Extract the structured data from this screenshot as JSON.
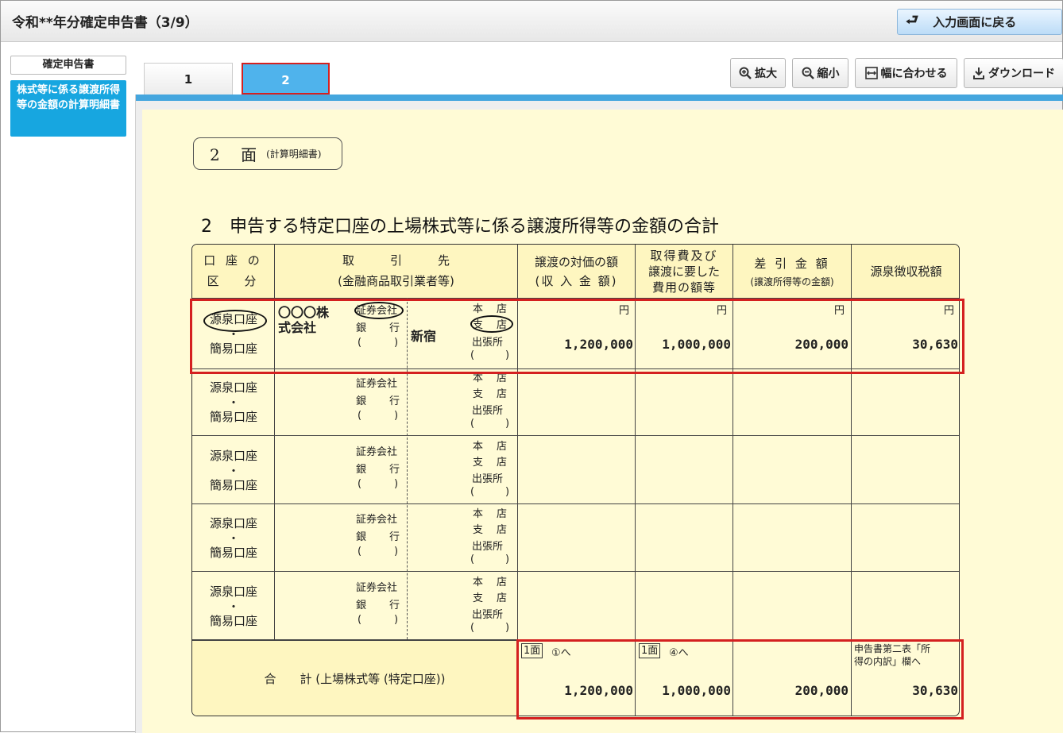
{
  "header": {
    "title": "令和**年分確定申告書（3/9）",
    "back_label": "入力画面に戻る"
  },
  "nav": {
    "title": "確定申告書",
    "item": "株式等に係る譲渡所得等の金額の計算明細書"
  },
  "tabs": [
    {
      "label": "1"
    },
    {
      "label": "2"
    }
  ],
  "toolbar": {
    "zoom_in": "拡大",
    "zoom_out": "縮小",
    "fit_width": "幅に合わせる",
    "download": "ダウンロード"
  },
  "document": {
    "badge_main": "2 面",
    "badge_sub": "(計算明細書)",
    "section_title": "2　申告する特定口座の上場株式等に係る譲渡所得等の金額の合計",
    "headers": {
      "account_type_1": "口 座 の",
      "account_type_2": "区　 分",
      "counterparty_1": "取　　　引　　　先",
      "counterparty_2": "(金融商品取引業者等)",
      "proceeds_1": "譲渡の対価の額",
      "proceeds_2": "(収 入 金 額)",
      "cost_1": "取得費及び",
      "cost_2": "譲渡に要した",
      "cost_3": "費用の額等",
      "diff_1": "差 引 金 額",
      "diff_2": "(譲渡所得等の金額)",
      "tax": "源泉徴収税額"
    },
    "account_labels": {
      "gensen": "源泉口座",
      "dot": "・",
      "kan-i": "簡易口座"
    },
    "firm_labels": {
      "securities": "証券会社",
      "bank_1": "銀",
      "bank_2": "行",
      "paren_open": "(",
      "paren_close": ")"
    },
    "branch_labels": {
      "main_1": "本",
      "main_2": "店",
      "branch_1": "支",
      "branch_2": "店",
      "office": "出張所",
      "paren_open": "(",
      "paren_close": ")"
    },
    "yen": "円",
    "row1": {
      "firm_name_1": "〇〇〇株",
      "firm_name_2": "式会社",
      "branch_name": "新宿",
      "proceeds": "1,200,000",
      "cost": "1,000,000",
      "diff": "200,000",
      "tax": "30,630"
    },
    "total": {
      "label": "合　　計 (上場株式等 (特定口座))",
      "proceeds_ref_box": "1面",
      "proceeds_ref": "①へ",
      "cost_ref_box": "1面",
      "cost_ref": "④へ",
      "tax_ref_1": "申告書第二表「所",
      "tax_ref_2": "得の内訳」欄へ",
      "proceeds": "1,200,000",
      "cost": "1,000,000",
      "diff": "200,000",
      "tax": "30,630"
    }
  }
}
